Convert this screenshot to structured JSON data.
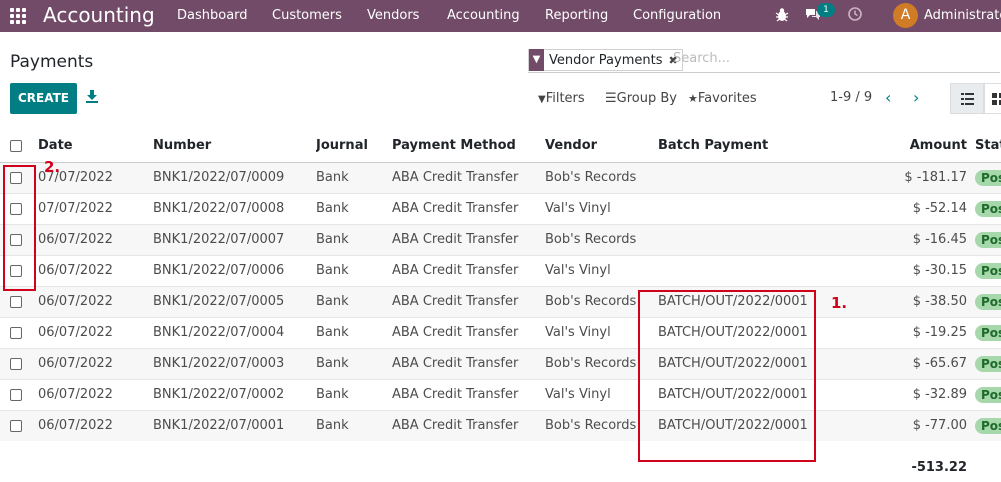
{
  "navbar": {
    "brand": "Accounting",
    "menu": [
      "Dashboard",
      "Customers",
      "Vendors",
      "Accounting",
      "Reporting",
      "Configuration"
    ],
    "messages_count": "1",
    "avatar_letter": "A",
    "user_name": "Administrator"
  },
  "page": {
    "title": "Payments",
    "create_label": "CREATE"
  },
  "search": {
    "facet_label": "Vendor Payments",
    "placeholder": "Search..."
  },
  "controls": {
    "filters": "Filters",
    "group_by": "Group By",
    "favorites": "Favorites",
    "pager": "1-9 / 9"
  },
  "table": {
    "columns": [
      "Date",
      "Number",
      "Journal",
      "Payment Method",
      "Vendor",
      "Batch Payment",
      "Amount",
      "Status"
    ],
    "rows": [
      {
        "date": "07/07/2022",
        "number": "BNK1/2022/07/0009",
        "journal": "Bank",
        "method": "ABA Credit Transfer",
        "vendor": "Bob's Records",
        "batch": "",
        "amount": "$ -181.17",
        "status": "Posted"
      },
      {
        "date": "07/07/2022",
        "number": "BNK1/2022/07/0008",
        "journal": "Bank",
        "method": "ABA Credit Transfer",
        "vendor": "Val's Vinyl",
        "batch": "",
        "amount": "$ -52.14",
        "status": "Posted"
      },
      {
        "date": "06/07/2022",
        "number": "BNK1/2022/07/0007",
        "journal": "Bank",
        "method": "ABA Credit Transfer",
        "vendor": "Bob's Records",
        "batch": "",
        "amount": "$ -16.45",
        "status": "Posted"
      },
      {
        "date": "06/07/2022",
        "number": "BNK1/2022/07/0006",
        "journal": "Bank",
        "method": "ABA Credit Transfer",
        "vendor": "Val's Vinyl",
        "batch": "",
        "amount": "$ -30.15",
        "status": "Posted"
      },
      {
        "date": "06/07/2022",
        "number": "BNK1/2022/07/0005",
        "journal": "Bank",
        "method": "ABA Credit Transfer",
        "vendor": "Bob's Records",
        "batch": "BATCH/OUT/2022/0001",
        "amount": "$ -38.50",
        "status": "Posted"
      },
      {
        "date": "06/07/2022",
        "number": "BNK1/2022/07/0004",
        "journal": "Bank",
        "method": "ABA Credit Transfer",
        "vendor": "Val's Vinyl",
        "batch": "BATCH/OUT/2022/0001",
        "amount": "$ -19.25",
        "status": "Posted"
      },
      {
        "date": "06/07/2022",
        "number": "BNK1/2022/07/0003",
        "journal": "Bank",
        "method": "ABA Credit Transfer",
        "vendor": "Bob's Records",
        "batch": "BATCH/OUT/2022/0001",
        "amount": "$ -65.67",
        "status": "Posted"
      },
      {
        "date": "06/07/2022",
        "number": "BNK1/2022/07/0002",
        "journal": "Bank",
        "method": "ABA Credit Transfer",
        "vendor": "Val's Vinyl",
        "batch": "BATCH/OUT/2022/0001",
        "amount": "$ -32.89",
        "status": "Posted"
      },
      {
        "date": "06/07/2022",
        "number": "BNK1/2022/07/0001",
        "journal": "Bank",
        "method": "ABA Credit Transfer",
        "vendor": "Bob's Records",
        "batch": "BATCH/OUT/2022/0001",
        "amount": "$ -77.00",
        "status": "Posted"
      }
    ],
    "total": "-513.22"
  },
  "annotations": {
    "label_1": "1.",
    "label_2": "2."
  }
}
